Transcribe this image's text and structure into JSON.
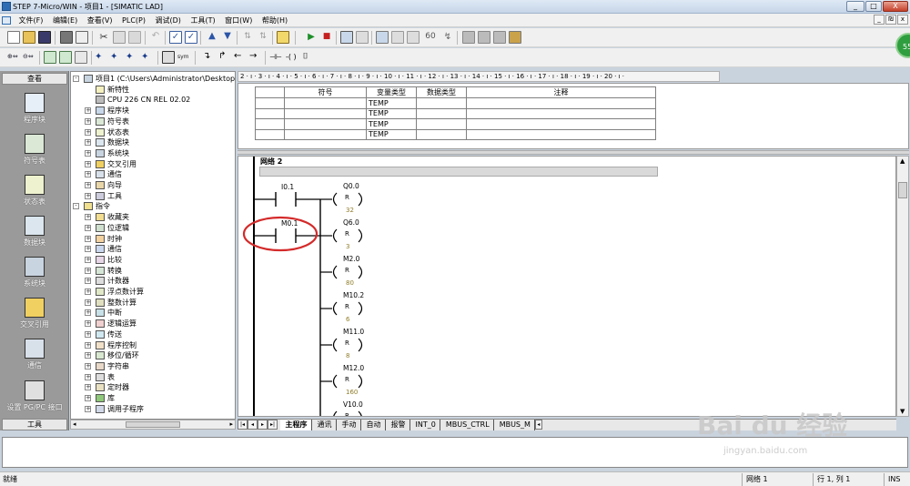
{
  "window": {
    "title": "STEP 7-Micro/WIN - 项目1 - [SIMATIC LAD]",
    "min": "_",
    "max": "□",
    "close": "X",
    "mdi_min": "_",
    "mdi_restore": "₪",
    "mdi_close": "x"
  },
  "menu": [
    "文件(F)",
    "编辑(E)",
    "查看(V)",
    "PLC(P)",
    "调试(D)",
    "工具(T)",
    "窗口(W)",
    "帮助(H)"
  ],
  "badge": "55",
  "left_nav": {
    "header": "查看",
    "items": [
      "程序块",
      "符号表",
      "状态表",
      "数据块",
      "系统块",
      "交叉引用",
      "通信",
      "设置 PG/PC 接口"
    ],
    "footer": "工具"
  },
  "tree": {
    "root": "项目1 (C:\\Users\\Administrator\\Desktop\\汇",
    "items": [
      {
        "label": "新特性",
        "level": 1,
        "expander": ""
      },
      {
        "label": "CPU 226 CN REL 02.02",
        "level": 1,
        "expander": ""
      },
      {
        "label": "程序块",
        "level": 1,
        "expander": "+"
      },
      {
        "label": "符号表",
        "level": 1,
        "expander": "+"
      },
      {
        "label": "状态表",
        "level": 1,
        "expander": "+"
      },
      {
        "label": "数据块",
        "level": 1,
        "expander": "+"
      },
      {
        "label": "系统块",
        "level": 1,
        "expander": "+"
      },
      {
        "label": "交叉引用",
        "level": 1,
        "expander": "+"
      },
      {
        "label": "通信",
        "level": 1,
        "expander": "+"
      },
      {
        "label": "向导",
        "level": 1,
        "expander": "+"
      },
      {
        "label": "工具",
        "level": 1,
        "expander": "+"
      },
      {
        "label": "指令",
        "level": 0,
        "expander": "-"
      },
      {
        "label": "收藏夹",
        "level": 1,
        "expander": "+"
      },
      {
        "label": "位逻辑",
        "level": 1,
        "expander": "+"
      },
      {
        "label": "时钟",
        "level": 1,
        "expander": "+"
      },
      {
        "label": "通信",
        "level": 1,
        "expander": "+"
      },
      {
        "label": "比较",
        "level": 1,
        "expander": "+"
      },
      {
        "label": "转换",
        "level": 1,
        "expander": "+"
      },
      {
        "label": "计数器",
        "level": 1,
        "expander": "+"
      },
      {
        "label": "浮点数计算",
        "level": 1,
        "expander": "+"
      },
      {
        "label": "整数计算",
        "level": 1,
        "expander": "+"
      },
      {
        "label": "中断",
        "level": 1,
        "expander": "+"
      },
      {
        "label": "逻辑运算",
        "level": 1,
        "expander": "+"
      },
      {
        "label": "传送",
        "level": 1,
        "expander": "+"
      },
      {
        "label": "程序控制",
        "level": 1,
        "expander": "+"
      },
      {
        "label": "移位/循环",
        "level": 1,
        "expander": "+"
      },
      {
        "label": "字符串",
        "level": 1,
        "expander": "+"
      },
      {
        "label": "表",
        "level": 1,
        "expander": "+"
      },
      {
        "label": "定时器",
        "level": 1,
        "expander": "+"
      },
      {
        "label": "库",
        "level": 1,
        "expander": "+"
      },
      {
        "label": "调用子程序",
        "level": 1,
        "expander": "+"
      }
    ]
  },
  "ruler": "2 · ı · 3 · ı · 4 · ı · 5 · ı · 6 · ı · 7 · ı · 8 · ı · 9 · ı · 10 · ı · 11 · ı · 12 · ı · 13 · ı · 14 · ı · 15 · ı · 16 · ı · 17 · ı · 18 · ı · 19 · ı · 20 · ı ·",
  "var_table": {
    "headers": [
      "",
      "符号",
      "变量类型",
      "数据类型",
      "注释"
    ],
    "rows": [
      [
        "",
        "",
        "TEMP",
        "",
        ""
      ],
      [
        "",
        "",
        "TEMP",
        "",
        ""
      ],
      [
        "",
        "",
        "TEMP",
        "",
        ""
      ],
      [
        "",
        "",
        "TEMP",
        "",
        ""
      ]
    ]
  },
  "ladder": {
    "network_title": "网络 2",
    "contacts": [
      "I0.1",
      "M0.1"
    ],
    "coil_text": "R",
    "coils": [
      {
        "name": "Q0.0",
        "value": "32"
      },
      {
        "name": "Q6.0",
        "value": "3"
      },
      {
        "name": "M2.0",
        "value": "80"
      },
      {
        "name": "M10.2",
        "value": "6"
      },
      {
        "name": "M11.0",
        "value": "8"
      },
      {
        "name": "M12.0",
        "value": "160"
      },
      {
        "name": "V10.0",
        "value": ""
      }
    ]
  },
  "tabs": [
    "主程序",
    "通讯",
    "手动",
    "自动",
    "报警",
    "INT_0",
    "MBUS_CTRL",
    "MBUS_M"
  ],
  "status": {
    "left": "就绪",
    "network": "网络 1",
    "position": "行 1, 列 1",
    "mode": "INS"
  },
  "watermark": {
    "main": "Bai du 经验",
    "sub": "jingyan.baidu.com"
  },
  "colors": {
    "highlight_circle": "#d42a2a",
    "coil_value": "#8f7d2a",
    "badge": "#2f9e3f"
  }
}
